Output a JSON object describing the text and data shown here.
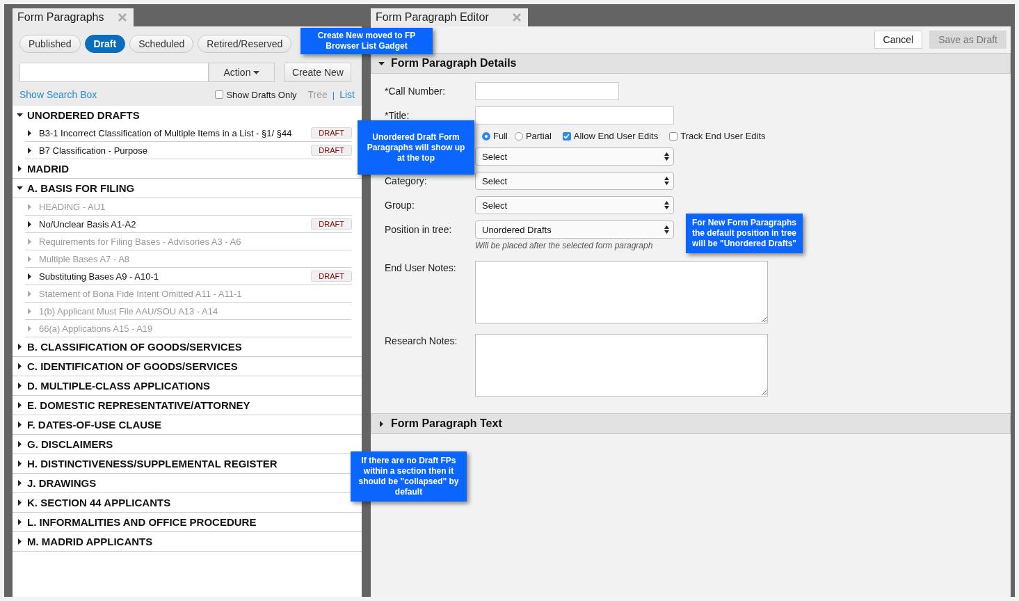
{
  "left_panel": {
    "tab": {
      "title": "Form Paragraphs"
    },
    "status_filters": [
      {
        "label": "Published",
        "selected": false
      },
      {
        "label": "Draft",
        "selected": true
      },
      {
        "label": "Scheduled",
        "selected": false
      },
      {
        "label": "Retired/Reserved",
        "selected": false
      }
    ],
    "action_button": "Action",
    "create_button": "Create New",
    "show_search_link": "Show Search Box",
    "show_drafts_only": {
      "label": "Show Drafts Only",
      "checked": false
    },
    "view_toggle": [
      {
        "label": "Tree",
        "selected": true
      },
      {
        "label": "List",
        "selected": false
      }
    ],
    "view_separator": "|",
    "tree": [
      {
        "label": "UNORDERED DRAFTS",
        "expanded": true,
        "children": [
          {
            "label": "B3-1 Incorrect Classification of Multiple Items in a List - §1/ §44",
            "badge": "DRAFT",
            "muted": false
          },
          {
            "label": "B7 Classification - Purpose",
            "badge": "DRAFT",
            "muted": false
          }
        ]
      },
      {
        "label": "MADRID",
        "expanded": false
      },
      {
        "label": "A. BASIS FOR FILING",
        "expanded": true,
        "children": [
          {
            "label": "HEADING - AU1",
            "muted": true
          },
          {
            "label": "No/Unclear Basis A1-A2",
            "badge": "DRAFT",
            "muted": false
          },
          {
            "label": "Requirements for Filing Bases - Advisories A3 - A6",
            "muted": true
          },
          {
            "label": "Multiple Bases A7 - A8",
            "muted": true
          },
          {
            "label": "Substituting Bases A9 - A10-1",
            "badge": "DRAFT",
            "muted": false
          },
          {
            "label": "Statement of Bona Fide Intent Omitted A11 - A11-1",
            "muted": true
          },
          {
            "label": "1(b) Applicant Must File AAU/SOU A13 - A14",
            "muted": true
          },
          {
            "label": "66(a) Applications A15 - A19",
            "muted": true
          }
        ]
      },
      {
        "label": "B. CLASSIFICATION OF GOODS/SERVICES",
        "expanded": false
      },
      {
        "label": "C. IDENTIFICATION OF GOODS/SERVICES",
        "expanded": false
      },
      {
        "label": "D. MULTIPLE-CLASS APPLICATIONS",
        "expanded": false
      },
      {
        "label": "E. DOMESTIC REPRESENTATIVE/ATTORNEY",
        "expanded": false
      },
      {
        "label": "F. DATES-OF-USE CLAUSE",
        "expanded": false
      },
      {
        "label": "G. DISCLAIMERS",
        "expanded": false
      },
      {
        "label": "H. DISTINCTIVENESS/SUPPLEMENTAL REGISTER",
        "expanded": false
      },
      {
        "label": "J. DRAWINGS",
        "expanded": false
      },
      {
        "label": "K. SECTION 44 APPLICANTS",
        "expanded": false
      },
      {
        "label": "L. INFORMALITIES AND OFFICE PROCEDURE",
        "expanded": false
      },
      {
        "label": "M. MADRID APPLICANTS",
        "expanded": false
      }
    ]
  },
  "editor": {
    "tab": {
      "title": "Form Paragraph Editor"
    },
    "buttons": [
      {
        "label": "Cancel",
        "disabled": false
      },
      {
        "label": "Save as Draft",
        "disabled": true
      }
    ],
    "details": {
      "title": "Form Paragraph Details",
      "expanded": true,
      "rows": [
        {
          "kind": "short_text",
          "label": "*Call Number:"
        },
        {
          "kind": "text",
          "label": "*Title:"
        },
        {
          "kind": "options",
          "radios": [
            {
              "label": "Full",
              "selected": true
            },
            {
              "label": "Partial",
              "selected": false
            }
          ],
          "checkboxes": [
            {
              "label": "Allow End User Edits",
              "checked": true
            },
            {
              "label": "Track End User Edits",
              "checked": false
            }
          ]
        },
        {
          "kind": "select",
          "value": "Select"
        },
        {
          "kind": "select",
          "label": "Category:",
          "value": "Select"
        },
        {
          "kind": "select",
          "label": "Group:",
          "value": "Select"
        },
        {
          "kind": "select",
          "label": "Position in tree:",
          "value": "Unordered Drafts",
          "hint": "Will be placed after the selected form paragraph"
        },
        {
          "kind": "textarea",
          "label": "End User Notes:"
        },
        {
          "kind": "textarea",
          "label": "Research Notes:"
        }
      ]
    },
    "text_section": {
      "title": "Form Paragraph Text",
      "expanded": false
    }
  },
  "callouts": [
    {
      "text": "Create New moved to FP Browser List Gadget"
    },
    {
      "text": "Unordered Draft Form Paragraphs will show up at the top"
    },
    {
      "text": "For New Form Paragraphs the default position in tree will be \"Unordered Drafts\""
    },
    {
      "text": "If there are no Draft FPs within a section then it should be \"collapsed\" by default"
    }
  ]
}
